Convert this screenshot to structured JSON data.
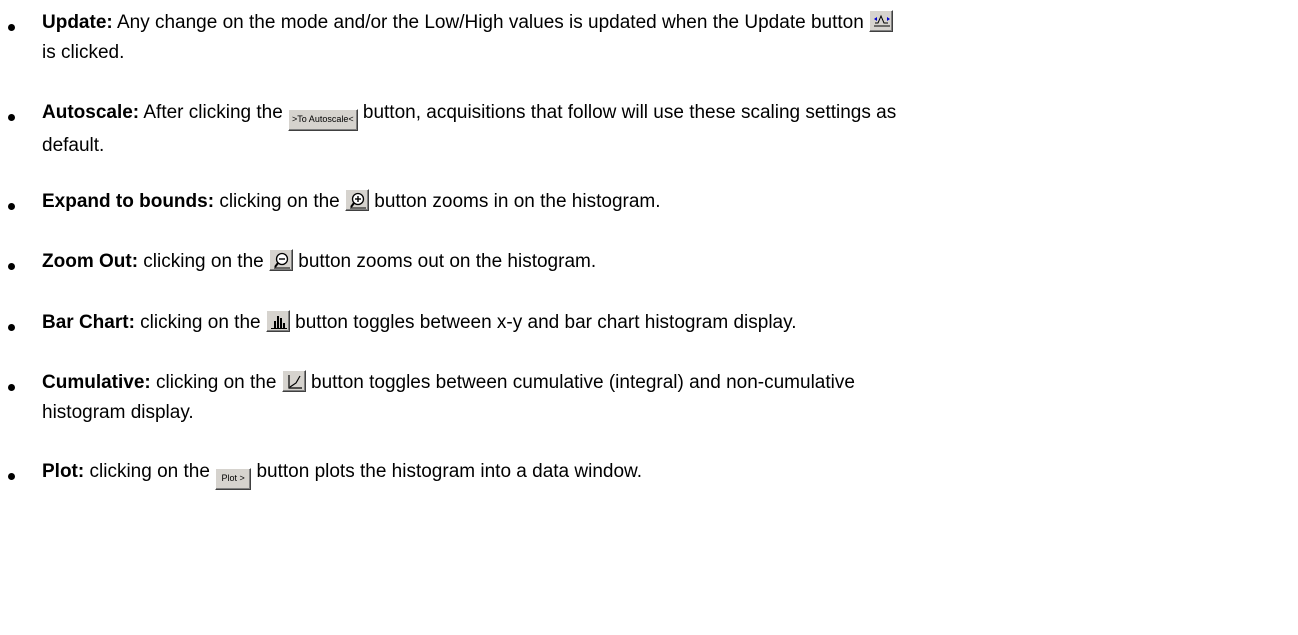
{
  "items": [
    {
      "term": "Update:",
      "before": " Any change on the mode and/or the Low/High values is updated when the Update button ",
      "after": "",
      "line2": "is clicked.",
      "button_icon": "update-icon"
    },
    {
      "term": "Autoscale:",
      "before": " After clicking the ",
      "button_label": ">To Autoscale<",
      "after": " button, acquisitions that follow will use these scaling settings as",
      "line2": "default."
    },
    {
      "term": "Expand to bounds:",
      "before": " clicking on the ",
      "button_icon": "zoom-in-icon",
      "after": " button zooms in on the histogram."
    },
    {
      "term": "Zoom Out:",
      "before": " clicking on the ",
      "button_icon": "zoom-out-icon",
      "after": " button zooms out on the histogram."
    },
    {
      "term": "Bar Chart:",
      "before": " clicking on the ",
      "button_icon": "bar-chart-icon",
      "after": " button toggles between x-y and bar chart histogram display."
    },
    {
      "term": "Cumulative:",
      "before": " clicking on the ",
      "button_icon": "cumulative-icon",
      "after": " button toggles between cumulative (integral) and non-cumulative",
      "line2": "histogram display."
    },
    {
      "term": "Plot:",
      "before": "  clicking on the ",
      "button_label": "Plot >",
      "after": " button plots the histogram into a data window."
    }
  ]
}
